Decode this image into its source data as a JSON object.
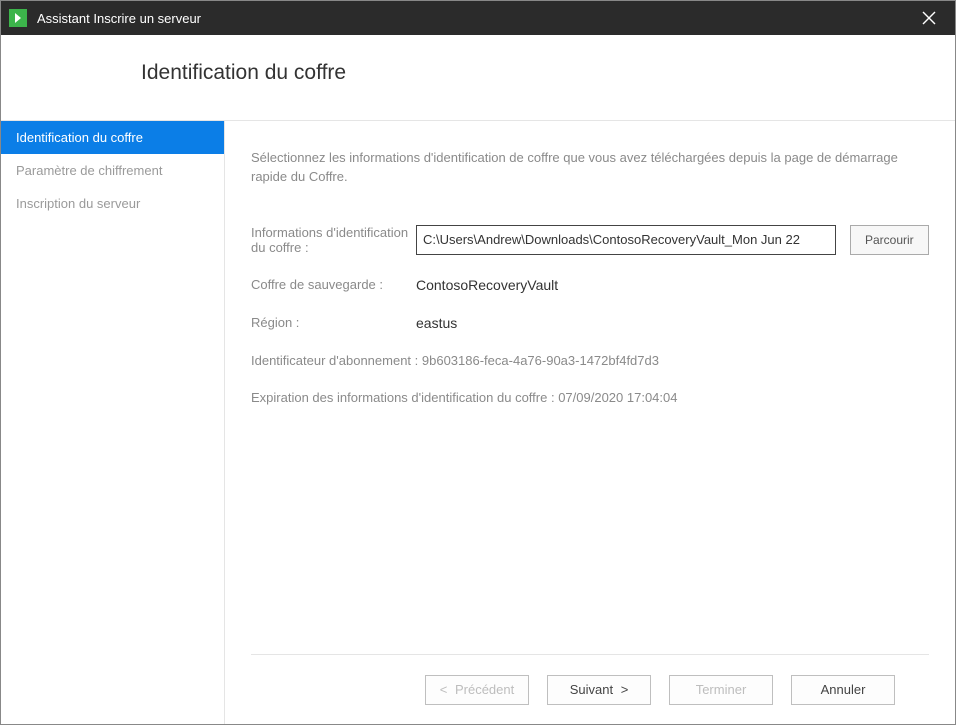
{
  "window": {
    "title": "Assistant Inscrire un serveur"
  },
  "header": {
    "page_title": "Identification du coffre"
  },
  "sidebar": {
    "items": [
      {
        "label": "Identification du coffre",
        "active": true
      },
      {
        "label": "Paramètre de chiffrement",
        "active": false
      },
      {
        "label": "Inscription du serveur",
        "active": false
      }
    ]
  },
  "main": {
    "instruction": "Sélectionnez les informations d'identification de coffre que vous avez téléchargées depuis la page de démarrage rapide du Coffre.",
    "credentials_label": "Informations d'identification du coffre :",
    "credentials_value": "C:\\Users\\Andrew\\Downloads\\ContosoRecoveryVault_Mon Jun 22",
    "browse_label": "Parcourir",
    "backup_vault_label": "Coffre de sauvegarde :",
    "backup_vault_value": "ContosoRecoveryVault",
    "region_label": "Région :",
    "region_value": "eastus",
    "subscription_label": "Identificateur d'abonnement :",
    "subscription_value": "9b603186-feca-4a76-90a3-1472bf4fd7d3",
    "expiration_label": "Expiration des informations d'identification du coffre :",
    "expiration_value": "07/09/2020 17:04:04"
  },
  "footer": {
    "previous": "Précédent",
    "next": "Suivant",
    "finish": "Terminer",
    "cancel": "Annuler"
  }
}
